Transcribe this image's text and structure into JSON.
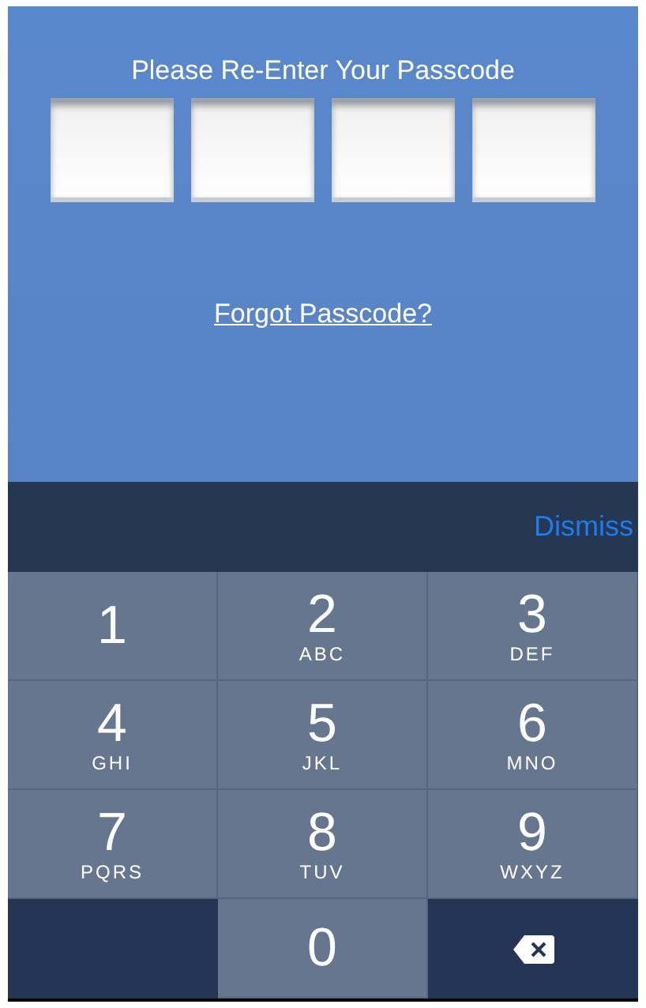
{
  "prompt": "Please Re-Enter Your Passcode",
  "passcode_boxes": [
    {
      "filled": false
    },
    {
      "filled": false
    },
    {
      "filled": false
    },
    {
      "filled": false
    }
  ],
  "forgot_link": "Forgot Passcode?",
  "accessory_bar": {
    "button": "Dismiss"
  },
  "keys": [
    {
      "kind": "digit",
      "digit": "1"
    },
    {
      "kind": "digit",
      "digit": "2",
      "letters": "ABC"
    },
    {
      "kind": "digit",
      "digit": "3",
      "letters": "DEF"
    },
    {
      "kind": "digit",
      "digit": "4",
      "letters": "GHI"
    },
    {
      "kind": "digit",
      "digit": "5",
      "letters": "JKL"
    },
    {
      "kind": "digit",
      "digit": "6",
      "letters": "MNO"
    },
    {
      "kind": "digit",
      "digit": "7",
      "letters": "PQRS"
    },
    {
      "kind": "digit",
      "digit": "8",
      "letters": "TUV"
    },
    {
      "kind": "digit",
      "digit": "9",
      "letters": "WXYZ"
    },
    {
      "kind": "blank"
    },
    {
      "kind": "digit",
      "digit": "0"
    },
    {
      "kind": "delete"
    }
  ]
}
